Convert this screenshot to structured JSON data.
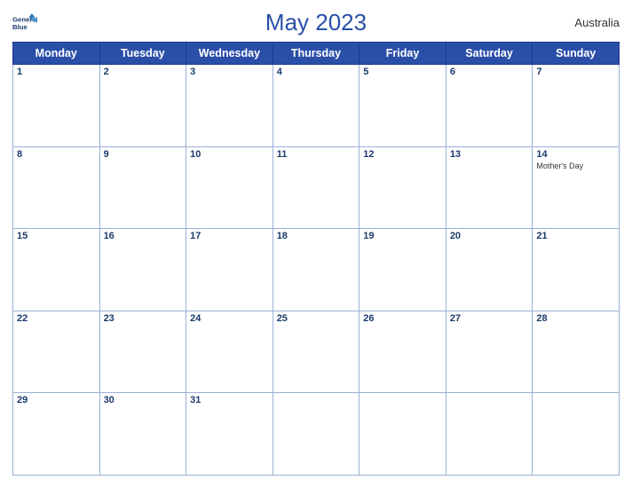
{
  "header": {
    "title": "May 2023",
    "country": "Australia",
    "logo": {
      "line1": "General",
      "line2": "Blue"
    }
  },
  "weekdays": [
    "Monday",
    "Tuesday",
    "Wednesday",
    "Thursday",
    "Friday",
    "Saturday",
    "Sunday"
  ],
  "weeks": [
    [
      {
        "day": "1",
        "event": "",
        "empty": false
      },
      {
        "day": "2",
        "event": "",
        "empty": false
      },
      {
        "day": "3",
        "event": "",
        "empty": false
      },
      {
        "day": "4",
        "event": "",
        "empty": false
      },
      {
        "day": "5",
        "event": "",
        "empty": false
      },
      {
        "day": "6",
        "event": "",
        "empty": false
      },
      {
        "day": "7",
        "event": "",
        "empty": false
      }
    ],
    [
      {
        "day": "8",
        "event": "",
        "empty": false
      },
      {
        "day": "9",
        "event": "",
        "empty": false
      },
      {
        "day": "10",
        "event": "",
        "empty": false
      },
      {
        "day": "11",
        "event": "",
        "empty": false
      },
      {
        "day": "12",
        "event": "",
        "empty": false
      },
      {
        "day": "13",
        "event": "",
        "empty": false
      },
      {
        "day": "14",
        "event": "Mother's Day",
        "empty": false
      }
    ],
    [
      {
        "day": "15",
        "event": "",
        "empty": false
      },
      {
        "day": "16",
        "event": "",
        "empty": false
      },
      {
        "day": "17",
        "event": "",
        "empty": false
      },
      {
        "day": "18",
        "event": "",
        "empty": false
      },
      {
        "day": "19",
        "event": "",
        "empty": false
      },
      {
        "day": "20",
        "event": "",
        "empty": false
      },
      {
        "day": "21",
        "event": "",
        "empty": false
      }
    ],
    [
      {
        "day": "22",
        "event": "",
        "empty": false
      },
      {
        "day": "23",
        "event": "",
        "empty": false
      },
      {
        "day": "24",
        "event": "",
        "empty": false
      },
      {
        "day": "25",
        "event": "",
        "empty": false
      },
      {
        "day": "26",
        "event": "",
        "empty": false
      },
      {
        "day": "27",
        "event": "",
        "empty": false
      },
      {
        "day": "28",
        "event": "",
        "empty": false
      }
    ],
    [
      {
        "day": "29",
        "event": "",
        "empty": false
      },
      {
        "day": "30",
        "event": "",
        "empty": false
      },
      {
        "day": "31",
        "event": "",
        "empty": false
      },
      {
        "day": "",
        "event": "",
        "empty": true
      },
      {
        "day": "",
        "event": "",
        "empty": true
      },
      {
        "day": "",
        "event": "",
        "empty": true
      },
      {
        "day": "",
        "event": "",
        "empty": true
      }
    ]
  ],
  "colors": {
    "header_bg": "#2a4fa8",
    "accent": "#1a3a6b",
    "border": "#9ab0d8"
  }
}
